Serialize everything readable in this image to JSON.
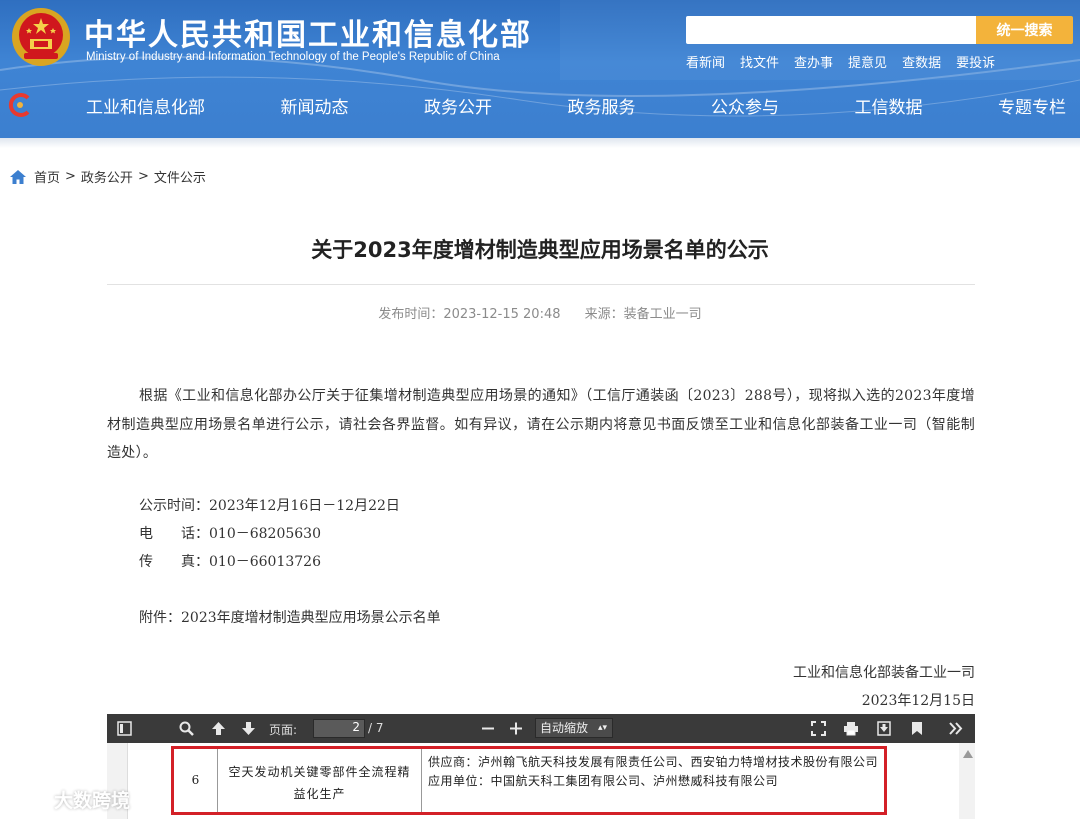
{
  "header": {
    "title": "中华人民共和国工业和信息化部",
    "subtitle": "Ministry of Industry and Information Technology of the People's Republic of China",
    "search_placeholder": "",
    "search_button": "统一搜索",
    "quick_links": [
      "看新闻",
      "找文件",
      "查办事",
      "提意见",
      "查数据",
      "要投诉"
    ],
    "nav": [
      "工业和信息化部",
      "新闻动态",
      "政务公开",
      "政务服务",
      "公众参与",
      "工信数据",
      "专题专栏"
    ],
    "colors": {
      "header_blue": "#3c7fcf",
      "search_button": "#f3b33b"
    }
  },
  "breadcrumb": {
    "items": [
      "首页",
      "政务公开",
      "文件公示"
    ],
    "separator": ">"
  },
  "article": {
    "title": "关于2023年度增材制造典型应用场景名单的公示",
    "publish_label": "发布时间：",
    "publish_time": "2023-12-15 20:48",
    "source_label": "来源：",
    "source": "装备工业一司",
    "paragraph": "根据《工业和信息化部办公厅关于征集增材制造典型应用场景的通知》（工信厅通装函〔2023〕288号），现将拟入选的2023年度增材制造典型应用场景名单进行公示，请社会各界监督。如有异议，请在公示期内将意见书面反馈至工业和信息化部装备工业一司（智能制造处）。",
    "period": "公示时间：2023年12月16日－12月22日",
    "phone": "电　　话：010－68205630",
    "fax": "传　　真：010－66013726",
    "attachment": "附件：2023年度增材制造典型应用场景公示名单",
    "signature_org": "工业和信息化部装备工业一司",
    "signature_date": "2023年12月15日"
  },
  "pdf_viewer": {
    "page_label": "页面:",
    "current_page": "2",
    "total_pages": "/ 7",
    "zoom": "自动缩放",
    "row": {
      "number": "6",
      "name": "空天发动机关键零部件全流程精益化生产",
      "supplier": "供应商：泸州翰飞航天科技发展有限责任公司、西安铂力特增材技术股份有限公司",
      "user_unit": "应用单位：中国航天科工集团有限公司、泸州懋威科技有限公司"
    },
    "highlight_color": "#d32027"
  },
  "watermark": "大数跨境"
}
